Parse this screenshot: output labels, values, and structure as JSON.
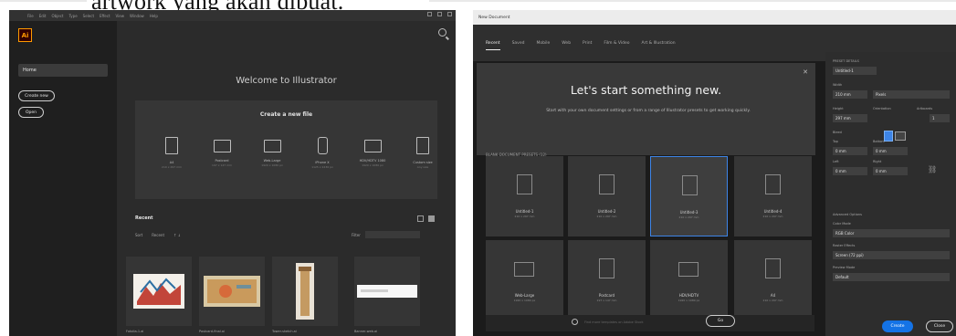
{
  "caption": "artwork yang akan dibuat.",
  "welcome_screen": {
    "menu": [
      "File",
      "Edit",
      "Object",
      "Type",
      "Select",
      "Effect",
      "View",
      "Window",
      "Help"
    ],
    "logo": "Ai",
    "sidebar": {
      "home": "Home",
      "new_file": "Create new",
      "open": "Open"
    },
    "welcome_title": "Welcome to Illustrator",
    "create_title": "Create a new file",
    "presets": [
      {
        "label": "A4",
        "size": "210 x 297 mm",
        "icon": "page-portrait-icon"
      },
      {
        "label": "Postcard",
        "size": "197 x 147 mm",
        "icon": "page-landscape-icon"
      },
      {
        "label": "Web-Large",
        "size": "1920 x 1080 px",
        "icon": "web-icon"
      },
      {
        "label": "iPhone X",
        "size": "1125 x 2436 px",
        "icon": "phone-icon"
      },
      {
        "label": "HDV/HDTV 1080",
        "size": "1920 x 1080 px",
        "icon": "monitor-icon"
      },
      {
        "label": "Custom size",
        "size": "Any size",
        "icon": "custom-size-icon"
      }
    ],
    "recent_label": "Recent",
    "sort_label": "Sort",
    "sort_value": "Recent",
    "filter_label": "Filter",
    "filter_placeholder": "Filter Recent Files",
    "recent_files": [
      {
        "name": "Fotolia-1.ai"
      },
      {
        "name": "Postcard-final.ai"
      },
      {
        "name": "Tower-sketch.ai"
      },
      {
        "name": "Banner-web.ai"
      }
    ]
  },
  "new_document": {
    "window_title": "New Document",
    "tabs": [
      "Recent",
      "Saved",
      "Mobile",
      "Web",
      "Print",
      "Film & Video",
      "Art & Illustration"
    ],
    "hero_title": "Let's start something new.",
    "hero_text": "Start with your own document settings or from a range of Illustrator presets to get working quickly.",
    "blank_label": "BLANK DOCUMENT PRESETS",
    "blank_count": "(12)",
    "presets_row1": [
      {
        "name": "Untitled-1",
        "size": "210 x 297 mm"
      },
      {
        "name": "Untitled-2",
        "size": "210 x 297 mm"
      },
      {
        "name": "Untitled-3",
        "size": "210 x 297 mm"
      },
      {
        "name": "Untitled-4",
        "size": "210 x 297 mm"
      }
    ],
    "presets_row2": [
      {
        "name": "Web-Large",
        "size": "1920 x 1080 px"
      },
      {
        "name": "Postcard",
        "size": "197 x 147 mm"
      },
      {
        "name": "HDV/HDTV",
        "size": "1920 x 1080 px"
      },
      {
        "name": "A4",
        "size": "210 x 297 mm"
      }
    ],
    "find_placeholder": "Find more templates on Adobe Stock",
    "go_label": "Go",
    "details": {
      "heading": "PRESET DETAILS",
      "name": "Untitled-1",
      "width_label": "Width",
      "width_value": "210 mm",
      "units_value": "Pixels",
      "height_label": "Height",
      "height_value": "297 mm",
      "orientation_label": "Orientation",
      "artboards_label": "Artboards",
      "artboards_value": "1",
      "bleed_label": "Bleed",
      "top_label": "Top",
      "top_value": "0 mm",
      "bottom_label": "Bottom",
      "bottom_value": "0 mm",
      "left_label": "Left",
      "left_value": "0 mm",
      "right_label": "Right",
      "right_value": "0 mm",
      "advanced_label": "Advanced Options",
      "color_mode_label": "Color Mode",
      "color_mode_value": "RGB Color",
      "raster_label": "Raster Effects",
      "raster_value": "Screen (72 ppi)",
      "preview_label": "Preview Mode",
      "preview_value": "Default"
    },
    "create_label": "Create",
    "close_label": "Close"
  }
}
